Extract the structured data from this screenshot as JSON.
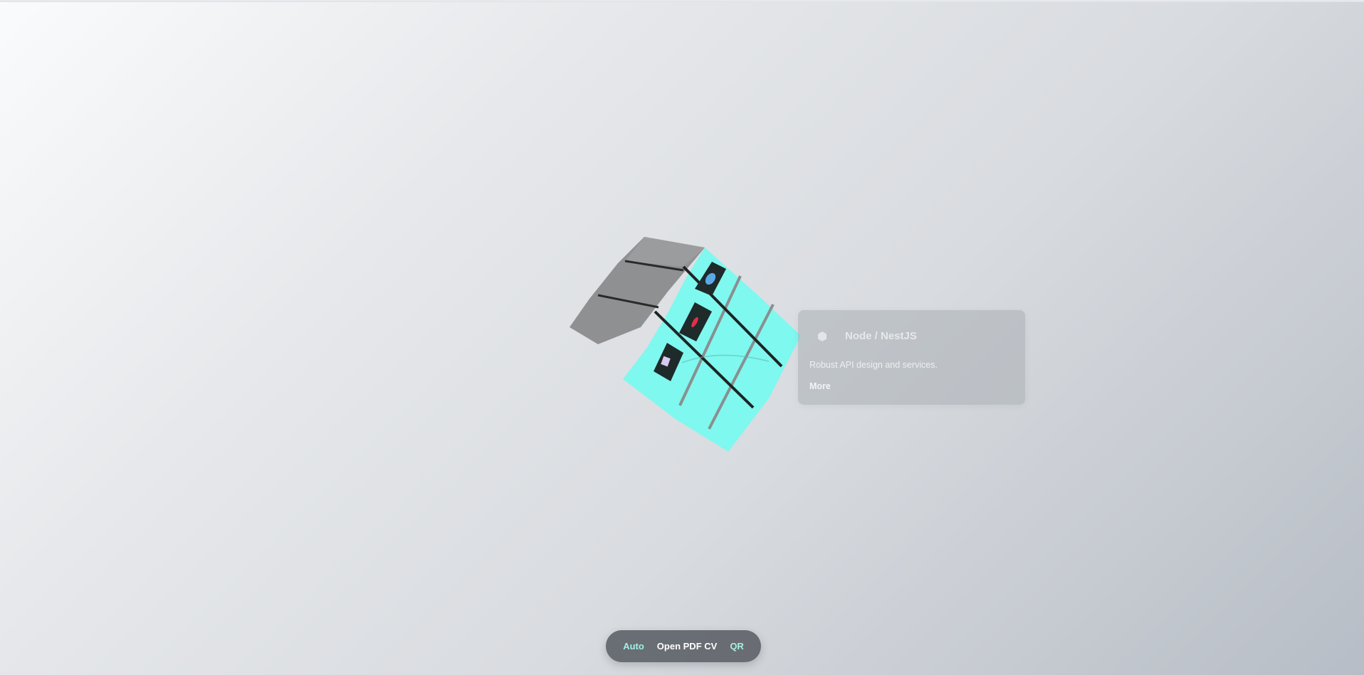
{
  "colors": {
    "accent": "#7ff8ef",
    "card_bg": "#aaaeb4",
    "toolbar_bg": "#60646a"
  },
  "card": {
    "icon": "hexagon-icon",
    "title": "Node / NestJS",
    "description": "Robust API design and services.",
    "more_label": "More"
  },
  "toolbar": {
    "auto_label": "Auto",
    "pdf_label": "Open PDF CV",
    "qr_label": "QR"
  }
}
